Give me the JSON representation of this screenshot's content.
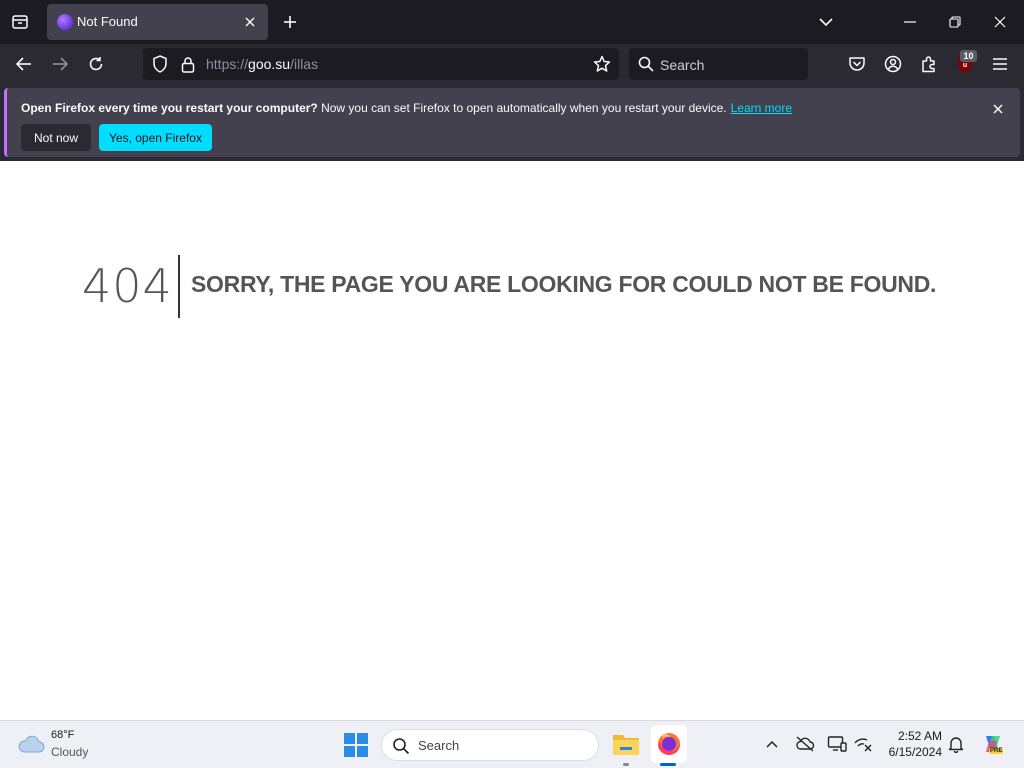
{
  "browser": {
    "tab": {
      "title": "Not Found"
    },
    "url": {
      "scheme": "https://",
      "host": "goo.su",
      "path": "/illas"
    },
    "search_placeholder": "Search",
    "ublock_badge": "10"
  },
  "notification": {
    "bold": "Open Firefox every time you restart your computer?",
    "text": " Now you can set Firefox to open automatically when you restart your device.",
    "link": "Learn more",
    "not_now": "Not now",
    "yes": "Yes, open Firefox"
  },
  "page": {
    "code": "404",
    "message": "SORRY, THE PAGE YOU ARE LOOKING FOR COULD NOT BE FOUND."
  },
  "taskbar": {
    "weather": {
      "temp": "68°F",
      "desc": "Cloudy"
    },
    "search_placeholder": "Search",
    "clock": {
      "time": "2:52 AM",
      "date": "6/15/2024"
    },
    "copilot_badge": "PRE"
  },
  "colors": {
    "accent": "#00ddff",
    "chrome_dark": "#1c1b22",
    "toolbar": "#2b2a33",
    "notice_bg": "#42414d",
    "error_text": "#555555"
  },
  "icons": {
    "tab_strip": [
      "tab-list-icon",
      "firefox-favicon-icon",
      "close-icon",
      "plus-icon",
      "chevron-down-icon",
      "minimize-icon",
      "restore-icon",
      "close-window-icon"
    ],
    "toolbar": [
      "back-arrow-icon",
      "forward-arrow-icon",
      "reload-icon",
      "shield-icon",
      "lock-icon",
      "star-icon",
      "search-icon",
      "pocket-icon",
      "account-icon",
      "extensions-icon",
      "ublock-icon",
      "hamburger-menu-icon"
    ],
    "taskbar": [
      "cloud-weather-icon",
      "windows-start-icon",
      "search-icon",
      "file-explorer-icon",
      "firefox-icon",
      "chevron-up-icon",
      "onedrive-icon",
      "display-icon",
      "network-icon",
      "bell-icon",
      "copilot-icon"
    ]
  }
}
